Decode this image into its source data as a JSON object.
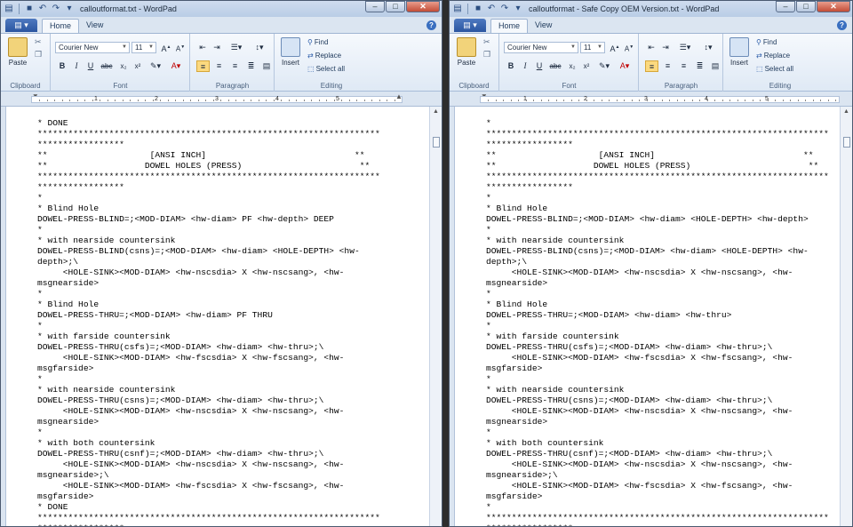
{
  "left": {
    "title": "calloutformat.txt - WordPad",
    "lines": [
      "* DONE",
      "*******************************************************************",
      "*****************",
      "**                    [ANSI INCH]                             **",
      "**                   DOWEL HOLES (PRESS)                       **",
      "*******************************************************************",
      "*****************",
      "*",
      "* Blind Hole",
      "DOWEL-PRESS-BLIND=;<MOD-DIAM> <hw-diam> PF <hw-depth> DEEP",
      "*",
      "* with nearside countersink",
      "DOWEL-PRESS-BLIND(csns)=;<MOD-DIAM> <hw-diam> <HOLE-DEPTH> <hw-",
      "depth>;\\",
      "     <HOLE-SINK><MOD-DIAM> <hw-nscsdia> X <hw-nscsang>, <hw-",
      "msgnearside>",
      "*",
      "* Blind Hole",
      "DOWEL-PRESS-THRU=;<MOD-DIAM> <hw-diam> PF THRU",
      "*",
      "* with farside countersink",
      "DOWEL-PRESS-THRU(csfs)=;<MOD-DIAM> <hw-diam> <hw-thru>;\\",
      "     <HOLE-SINK><MOD-DIAM> <hw-fscsdia> X <hw-fscsang>, <hw-",
      "msgfarside>",
      "*",
      "* with nearside countersink",
      "DOWEL-PRESS-THRU(csns)=;<MOD-DIAM> <hw-diam> <hw-thru>;\\",
      "     <HOLE-SINK><MOD-DIAM> <hw-nscsdia> X <hw-nscsang>, <hw-",
      "msgnearside>",
      "*",
      "* with both countersink",
      "DOWEL-PRESS-THRU(csnf)=;<MOD-DIAM> <hw-diam> <hw-thru>;\\",
      "     <HOLE-SINK><MOD-DIAM> <hw-nscsdia> X <hw-nscsang>, <hw-",
      "msgnearside>;\\",
      "     <HOLE-SINK><MOD-DIAM> <hw-fscsdia> X <hw-fscsang>, <hw-",
      "msgfarside>",
      "* DONE",
      "*******************************************************************",
      "*****************"
    ]
  },
  "right": {
    "title": "calloutformat - Safe Copy OEM Version.txt - WordPad",
    "lines": [
      "*",
      "*******************************************************************",
      "*****************",
      "**                    [ANSI INCH]                             **",
      "**                   DOWEL HOLES (PRESS)                       **",
      "*******************************************************************",
      "*****************",
      "*",
      "* Blind Hole",
      "DOWEL-PRESS-BLIND=;<MOD-DIAM> <hw-diam> <HOLE-DEPTH> <hw-depth>",
      "*",
      "* with nearside countersink",
      "DOWEL-PRESS-BLIND(csns)=;<MOD-DIAM> <hw-diam> <HOLE-DEPTH> <hw-",
      "depth>;\\",
      "     <HOLE-SINK><MOD-DIAM> <hw-nscsdia> X <hw-nscsang>, <hw-",
      "msgnearside>",
      "*",
      "* Blind Hole",
      "DOWEL-PRESS-THRU=;<MOD-DIAM> <hw-diam> <hw-thru>",
      "*",
      "* with farside countersink",
      "DOWEL-PRESS-THRU(csfs)=;<MOD-DIAM> <hw-diam> <hw-thru>;\\",
      "     <HOLE-SINK><MOD-DIAM> <hw-fscsdia> X <hw-fscsang>, <hw-",
      "msgfarside>",
      "*",
      "* with nearside countersink",
      "DOWEL-PRESS-THRU(csns)=;<MOD-DIAM> <hw-diam> <hw-thru>;\\",
      "     <HOLE-SINK><MOD-DIAM> <hw-nscsdia> X <hw-nscsang>, <hw-",
      "msgnearside>",
      "*",
      "* with both countersink",
      "DOWEL-PRESS-THRU(csnf)=;<MOD-DIAM> <hw-diam> <hw-thru>;\\",
      "     <HOLE-SINK><MOD-DIAM> <hw-nscsdia> X <hw-nscsang>, <hw-",
      "msgnearside>;\\",
      "     <HOLE-SINK><MOD-DIAM> <hw-fscsdia> X <hw-fscsang>, <hw-",
      "msgfarside>",
      "*",
      "*******************************************************************",
      "*****************"
    ]
  },
  "tabs": {
    "home": "Home",
    "view": "View"
  },
  "ribbon": {
    "paste": "Paste",
    "font_name": "Courier New",
    "font_size": "11",
    "insert": "Insert",
    "find": "Find",
    "replace": "Replace",
    "select_all": "Select all",
    "groups": {
      "clipboard": "Clipboard",
      "font": "Font",
      "paragraph": "Paragraph",
      "editing": "Editing"
    }
  },
  "ruler_numbers": [
    "1",
    "2",
    "3",
    "4",
    "5"
  ],
  "colors": {
    "accent": "#2a55a0",
    "ribbon_bg": "#dfe9f5",
    "highlight": "#fbd97f"
  }
}
